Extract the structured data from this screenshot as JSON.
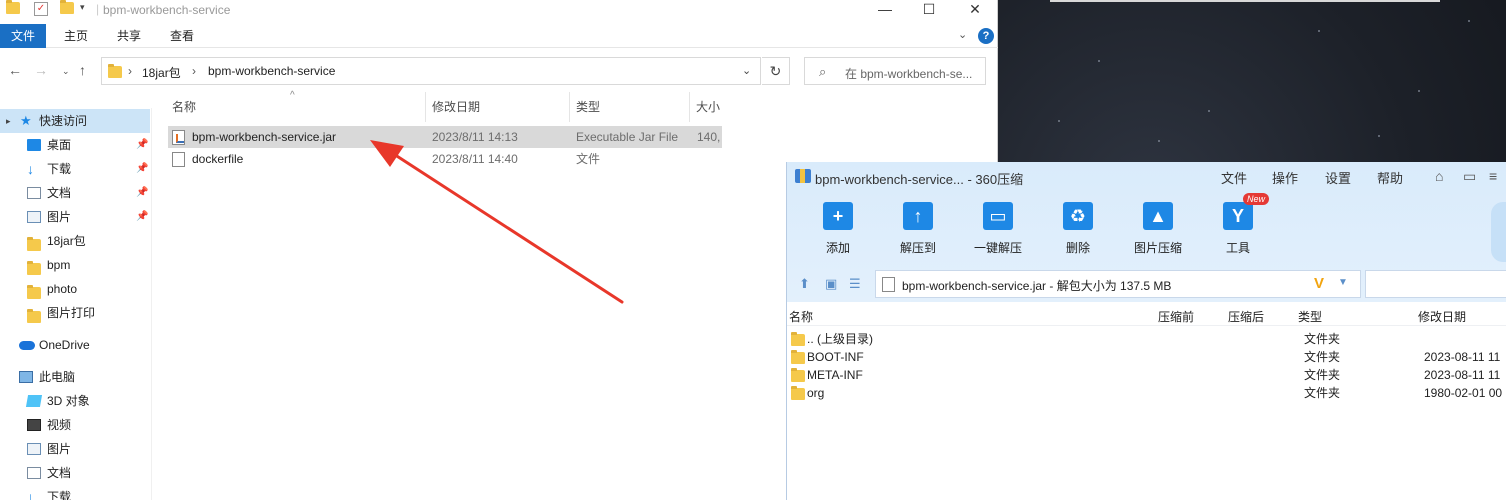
{
  "explorer": {
    "title": "bpm-workbench-service",
    "window_controls": {
      "minimize": "—",
      "maximize": "☐",
      "close": "✕"
    },
    "ribbon": {
      "file": "文件",
      "home": "主页",
      "share": "共享",
      "view": "查看",
      "help": "?"
    },
    "address": {
      "parent": "18jar包",
      "current": "bpm-workbench-service",
      "sep": "›"
    },
    "search_placeholder": "在 bpm-workbench-se...",
    "sidebar": [
      {
        "label": "快速访问",
        "icon": "star-icon"
      },
      {
        "label": "桌面",
        "icon": "desktop-icon",
        "pinned": true
      },
      {
        "label": "下载",
        "icon": "download-icon",
        "pinned": true
      },
      {
        "label": "文档",
        "icon": "document-icon",
        "pinned": true
      },
      {
        "label": "图片",
        "icon": "picture-icon",
        "pinned": true
      },
      {
        "label": "18jar包",
        "icon": "folder-icon"
      },
      {
        "label": "bpm",
        "icon": "folder-icon"
      },
      {
        "label": "photo",
        "icon": "folder-icon"
      },
      {
        "label": "图片打印",
        "icon": "folder-icon"
      },
      {
        "label": "OneDrive",
        "icon": "cloud-icon"
      },
      {
        "label": "此电脑",
        "icon": "computer-icon"
      },
      {
        "label": "3D 对象",
        "icon": "3d-object-icon"
      },
      {
        "label": "视频",
        "icon": "video-icon"
      },
      {
        "label": "图片",
        "icon": "picture-icon"
      },
      {
        "label": "文档",
        "icon": "document-icon"
      },
      {
        "label": "下载",
        "icon": "download-icon"
      }
    ],
    "columns": {
      "name": "名称",
      "modified": "修改日期",
      "type": "类型",
      "size": "大小"
    },
    "files": [
      {
        "name": "bpm-workbench-service.jar",
        "modified": "2023/8/11 14:13",
        "type": "Executable Jar File",
        "size": "140,",
        "selected": true
      },
      {
        "name": "dockerfile",
        "modified": "2023/8/11 14:40",
        "type": "文件",
        "size": ""
      }
    ]
  },
  "zip": {
    "title": "bpm-workbench-service... - 360压缩",
    "menu": {
      "file": "文件",
      "operate": "操作",
      "settings": "设置",
      "help": "帮助"
    },
    "tools": [
      {
        "label": "添加",
        "icon": "add-icon",
        "glyph": "+"
      },
      {
        "label": "解压到",
        "icon": "extract-to-icon",
        "glyph": "↑"
      },
      {
        "label": "一键解压",
        "icon": "one-click-extract-icon",
        "glyph": "▭"
      },
      {
        "label": "删除",
        "icon": "delete-icon",
        "glyph": "♻"
      },
      {
        "label": "图片压缩",
        "icon": "image-compress-icon",
        "glyph": "▲"
      },
      {
        "label": "工具",
        "icon": "tools-icon",
        "glyph": "Y"
      }
    ],
    "new_badge": "New",
    "path_text": "bpm-workbench-service.jar - 解包大小为 137.5 MB",
    "path_v": "V",
    "columns": {
      "name": "名称",
      "before": "压缩前",
      "after": "压缩后",
      "type": "类型",
      "modified": "修改日期"
    },
    "entries": [
      {
        "name": ".. (上级目录)",
        "type": "文件夹",
        "modified": ""
      },
      {
        "name": "BOOT-INF",
        "type": "文件夹",
        "modified": "2023-08-11 11"
      },
      {
        "name": "META-INF",
        "type": "文件夹",
        "modified": "2023-08-11 11"
      },
      {
        "name": "org",
        "type": "文件夹",
        "modified": "1980-02-01 00"
      }
    ]
  },
  "colors": {
    "accent": "#1a6fc4",
    "selection": "#cce4f7",
    "arrow": "#e8372a",
    "zip_header": "#dcecfb"
  }
}
